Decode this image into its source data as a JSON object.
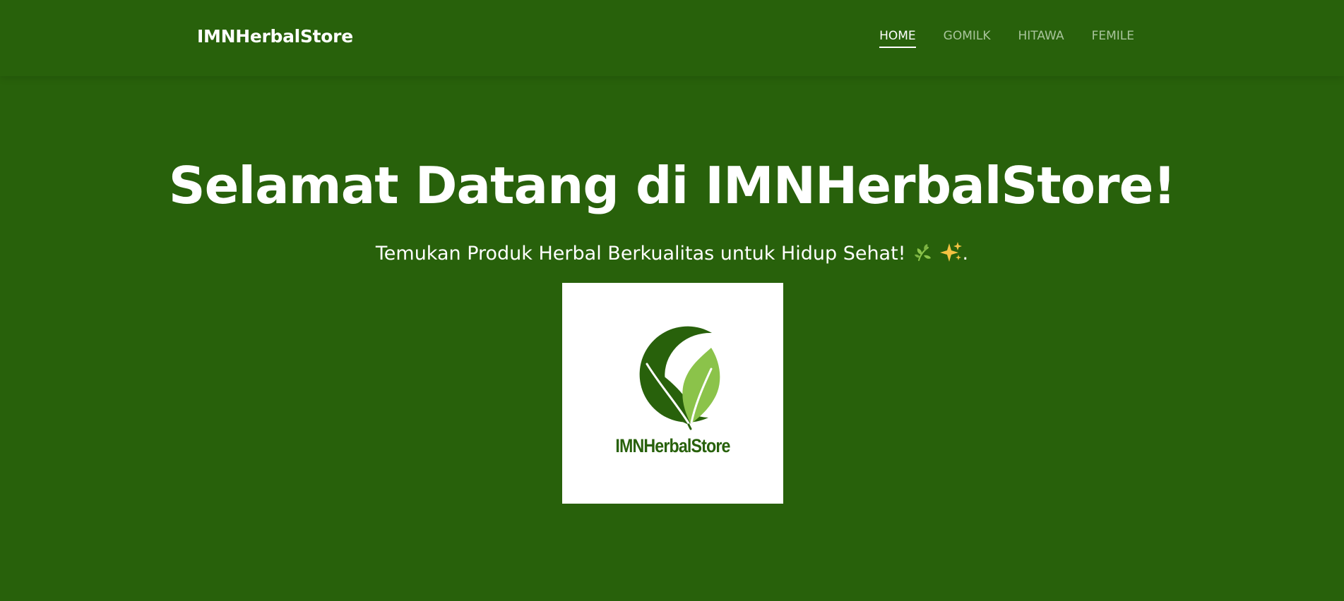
{
  "navbar": {
    "brand": "IMNHerbalStore",
    "links": [
      {
        "label": "HOME",
        "active": true
      },
      {
        "label": "GOMILK",
        "active": false
      },
      {
        "label": "HITAWA",
        "active": false
      },
      {
        "label": "FEMILE",
        "active": false
      }
    ]
  },
  "hero": {
    "title": "Selamat Datang di IMNHerbalStore!",
    "subtitle": "Temukan Produk Herbal Berkualitas untuk Hidup Sehat!",
    "subtitle_suffix": ".",
    "icons": [
      "herb-icon",
      "sparkles-icon"
    ]
  },
  "logo": {
    "wordmark": "IMNHerbalStore"
  },
  "colors": {
    "background": "#28610b",
    "nav_inactive": "#a8c49b",
    "logo_dark_green": "#28610b",
    "logo_light_green": "#8bc34a",
    "logo_card": "#ffffff"
  }
}
